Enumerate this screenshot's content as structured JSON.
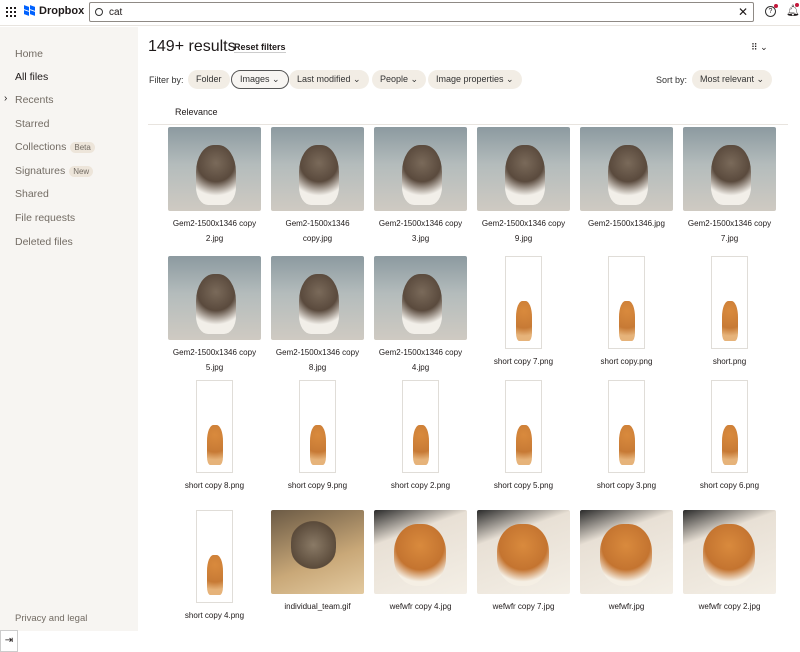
{
  "header": {
    "brand": "Dropbox",
    "search_value": "cat",
    "clear_icon": "close-icon",
    "help_icon": "help-icon",
    "notifications_icon": "bell-icon",
    "accent": "#0061fe"
  },
  "sidebar": {
    "items": [
      {
        "label": "Home"
      },
      {
        "label": "All files",
        "active": true
      },
      {
        "label": "Recents"
      },
      {
        "label": "Starred"
      },
      {
        "label": "Collections",
        "badge": "Beta"
      },
      {
        "label": "Signatures",
        "badge": "New"
      },
      {
        "label": "Shared"
      },
      {
        "label": "File requests"
      },
      {
        "label": "Deleted files"
      }
    ],
    "footer": "Privacy and legal"
  },
  "main": {
    "results": "149+ results",
    "reset": "Reset filters",
    "filter_label": "Filter by:",
    "filters": [
      {
        "label": "Folder"
      },
      {
        "label": "Images",
        "selected": true
      },
      {
        "label": "Last modified"
      },
      {
        "label": "People"
      },
      {
        "label": "Image properties"
      }
    ],
    "sort_label": "Sort by:",
    "sort_value": "Most relevant",
    "column": "Relevance",
    "files": [
      {
        "name": "Gem2-1500x1346 copy 2.jpg",
        "kind": "kitten"
      },
      {
        "name": "Gem2-1500x1346 copy.jpg",
        "kind": "kitten"
      },
      {
        "name": "Gem2-1500x1346 copy 3.jpg",
        "kind": "kitten"
      },
      {
        "name": "Gem2-1500x1346 copy 9.jpg",
        "kind": "kitten"
      },
      {
        "name": "Gem2-1500x1346.jpg",
        "kind": "kitten"
      },
      {
        "name": "Gem2-1500x1346 copy 7.jpg",
        "kind": "kitten"
      },
      {
        "name": "Gem2-1500x1346 copy 5.jpg",
        "kind": "kitten"
      },
      {
        "name": "Gem2-1500x1346 copy 8.jpg",
        "kind": "kitten"
      },
      {
        "name": "Gem2-1500x1346 copy 4.jpg",
        "kind": "kitten"
      },
      {
        "name": "short copy 7.png",
        "kind": "portrait"
      },
      {
        "name": "short copy.png",
        "kind": "portrait"
      },
      {
        "name": "short.png",
        "kind": "portrait"
      },
      {
        "name": "short copy 8.png",
        "kind": "portrait"
      },
      {
        "name": "short copy 9.png",
        "kind": "portrait"
      },
      {
        "name": "short copy 2.png",
        "kind": "portrait"
      },
      {
        "name": "short copy 5.png",
        "kind": "portrait"
      },
      {
        "name": "short copy 3.png",
        "kind": "portrait"
      },
      {
        "name": "short copy 6.png",
        "kind": "portrait"
      },
      {
        "name": "short copy 4.png",
        "kind": "portrait"
      },
      {
        "name": "individual_team.gif",
        "kind": "gif"
      },
      {
        "name": "wefwfr copy 4.jpg",
        "kind": "orange"
      },
      {
        "name": "wefwfr copy 7.jpg",
        "kind": "orange"
      },
      {
        "name": "wefwfr.jpg",
        "kind": "orange"
      },
      {
        "name": "wefwfr copy 2.jpg",
        "kind": "orange"
      }
    ]
  }
}
